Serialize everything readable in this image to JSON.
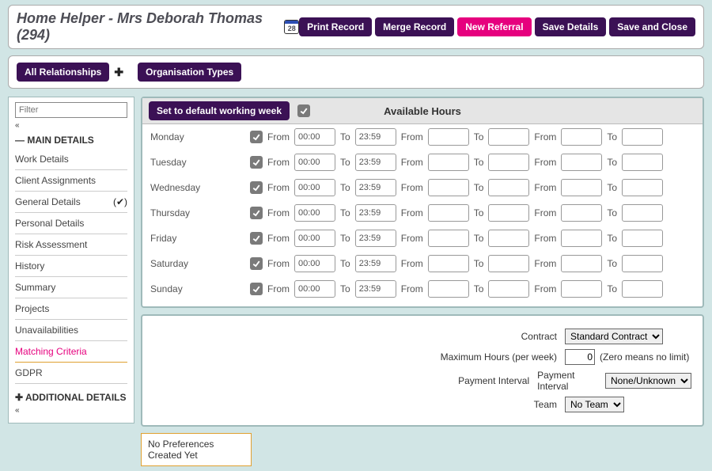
{
  "header": {
    "title": "Home Helper - Mrs Deborah Thomas (294)",
    "calendar_day": "28",
    "buttons": {
      "print": "Print Record",
      "merge": "Merge Record",
      "new_referral": "New Referral",
      "save_details": "Save Details",
      "save_close": "Save and Close"
    }
  },
  "relbar": {
    "all_relationships": "All Relationships",
    "org_types": "Organisation Types"
  },
  "sidebar": {
    "filter_placeholder": "Filter",
    "section_main": "— MAIN DETAILS",
    "section_additional": "✚ ADDITIONAL DETAILS",
    "items": [
      {
        "label": "Work Details"
      },
      {
        "label": "Client Assignments"
      },
      {
        "label": "General Details",
        "checked": true
      },
      {
        "label": "Personal Details"
      },
      {
        "label": "Risk Assessment"
      },
      {
        "label": "History"
      },
      {
        "label": "Summary"
      },
      {
        "label": "Projects"
      },
      {
        "label": "Unavailabilities"
      },
      {
        "label": "Matching Criteria",
        "active": true
      },
      {
        "label": "GDPR"
      }
    ]
  },
  "available": {
    "default_btn": "Set to default working week",
    "panel_title": "Available Hours",
    "from_label": "From",
    "to_label": "To",
    "days": [
      {
        "name": "Monday",
        "from": "00:00",
        "to": "23:59"
      },
      {
        "name": "Tuesday",
        "from": "00:00",
        "to": "23:59"
      },
      {
        "name": "Wednesday",
        "from": "00:00",
        "to": "23:59"
      },
      {
        "name": "Thursday",
        "from": "00:00",
        "to": "23:59"
      },
      {
        "name": "Friday",
        "from": "00:00",
        "to": "23:59"
      },
      {
        "name": "Saturday",
        "from": "00:00",
        "to": "23:59"
      },
      {
        "name": "Sunday",
        "from": "00:00",
        "to": "23:59"
      }
    ]
  },
  "contract": {
    "label": "Contract",
    "value": "Standard Contract",
    "max_hours_label": "Maximum Hours (per week)",
    "max_hours_value": "0",
    "max_hours_hint": "(Zero means no limit)",
    "payment_label": "Payment Interval",
    "payment_inline": "Payment Interval",
    "payment_value": "None/Unknown",
    "team_label": "Team",
    "team_value": "No Team"
  },
  "no_prefs": "No Preferences Created Yet"
}
